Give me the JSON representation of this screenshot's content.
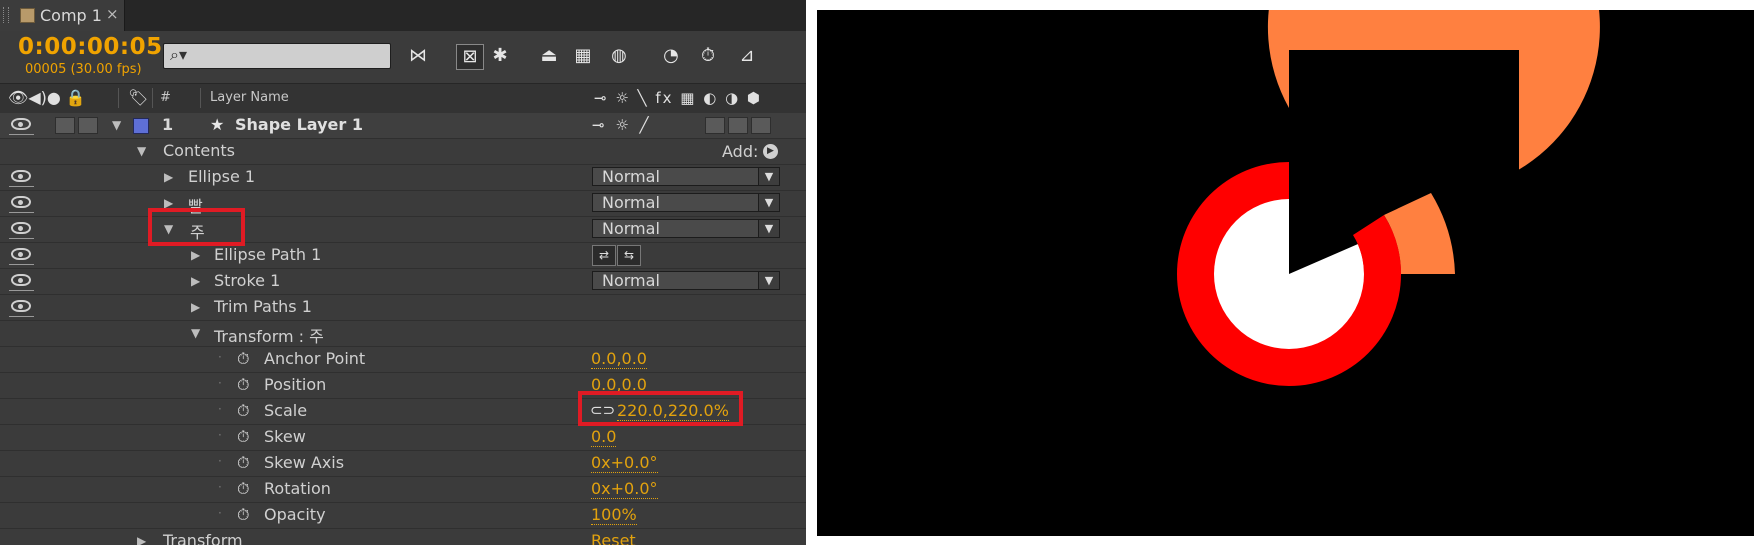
{
  "tab": {
    "label": "Comp 1",
    "close": "×"
  },
  "toolbar": {
    "timecode": "0:00:00:05",
    "fps": "00005 (30.00 fps)",
    "search_placeholder": "",
    "search_icon": "search-icon",
    "tools": [
      "graph-flow-icon",
      "draft-3d-icon",
      "shy-icon",
      "frame-blend-icon",
      "motion-blur-icon",
      "brainstorm-icon",
      "auto-keyframe-icon",
      "graph-editor-icon"
    ]
  },
  "columns": {
    "number": "#",
    "layer_name": "Layer Name",
    "switches": "⊸ ☼ ╲ fx ▦ ◐ ◑ ⬢"
  },
  "layer": {
    "index": "1",
    "name": "Shape Layer 1",
    "switches": "⊸ ☼ ╱",
    "label_color": "#5e6fd6"
  },
  "rows": {
    "contents": "Contents",
    "add": "Add:",
    "ellipse1": "Ellipse 1",
    "bbal": "빨",
    "ju": "주",
    "ellipse_path": "Ellipse Path 1",
    "stroke": "Stroke 1",
    "trim": "Trim Paths 1",
    "transform_group": "Transform : 주",
    "anchor_point": "Anchor Point",
    "position": "Position",
    "scale": "Scale",
    "skew": "Skew",
    "skew_axis": "Skew Axis",
    "rotation": "Rotation",
    "opacity": "Opacity",
    "transform": "Transform"
  },
  "values": {
    "blend_mode": "Normal",
    "anchor_point": "0.0,0.0",
    "position": "0.0,0.0",
    "scale": "220.0,220.0%",
    "skew": "0.0",
    "skew_axis": "0x+0.0°",
    "rotation": "0x+0.0°",
    "opacity": "100%",
    "transform_reset": "Reset"
  },
  "colors": {
    "timecode": "#f0a300",
    "value": "#e2a20e",
    "highlight": "#e01b24",
    "outer_ring": "#ff8040",
    "inner_ring": "#ff0000",
    "center": "#ffffff",
    "viewer_bg": "#000000"
  },
  "viewer": {
    "graphic": "donut-rings-graphic"
  }
}
